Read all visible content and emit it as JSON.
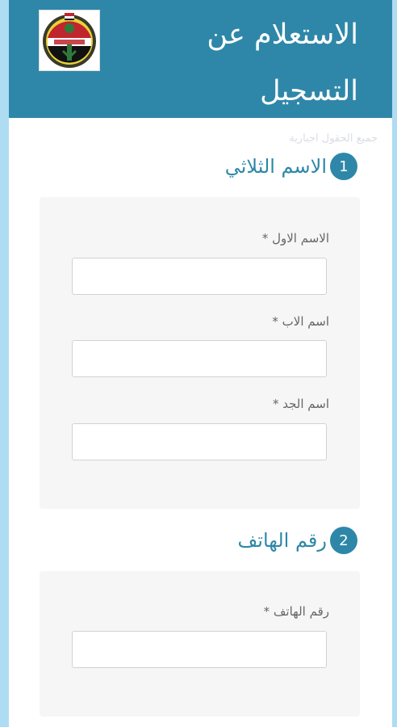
{
  "header": {
    "title": "الاستعلام عن التسجيل",
    "logo_name": "institution-logo"
  },
  "form": {
    "required_note": "جميع الحقول اجبارية",
    "sections": [
      {
        "number": "1",
        "title": "الاسم الثلاثي",
        "fields": [
          {
            "label": "الاسم الاول *",
            "value": "",
            "placeholder": ""
          },
          {
            "label": "اسم الاب *",
            "value": "",
            "placeholder": ""
          },
          {
            "label": "اسم الجد *",
            "value": "",
            "placeholder": ""
          }
        ]
      },
      {
        "number": "2",
        "title": "رقم الهاتف",
        "fields": [
          {
            "label": "رقم الهاتف *",
            "value": "",
            "placeholder": ""
          }
        ]
      }
    ]
  },
  "colors": {
    "accent": "#2e87a8",
    "page_background": "#aedcf3",
    "panel_background": "#f6f6f6"
  }
}
